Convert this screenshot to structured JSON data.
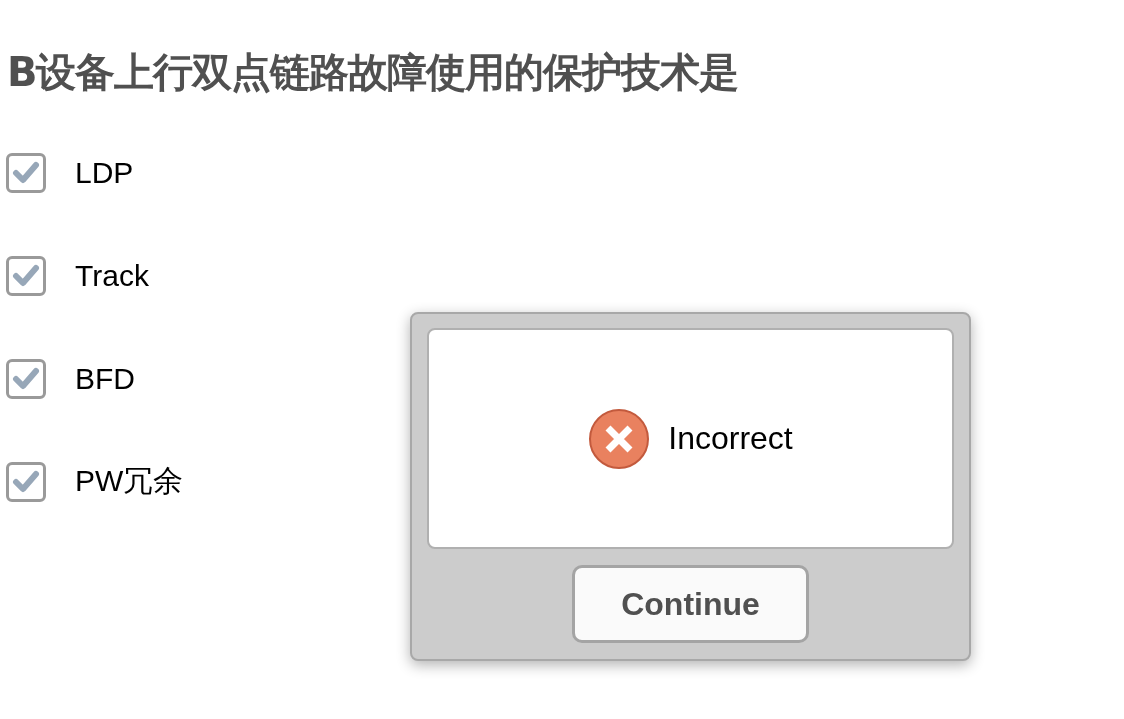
{
  "question": {
    "title": "B设备上行双点链路故障使用的保护技术是"
  },
  "options": [
    {
      "label": "LDP",
      "checked": true
    },
    {
      "label": "Track",
      "checked": true
    },
    {
      "label": "BFD",
      "checked": true
    },
    {
      "label": "PW冗余",
      "checked": true
    }
  ],
  "feedback": {
    "kind": "incorrect",
    "message": "Incorrect",
    "button": "Continue"
  }
}
